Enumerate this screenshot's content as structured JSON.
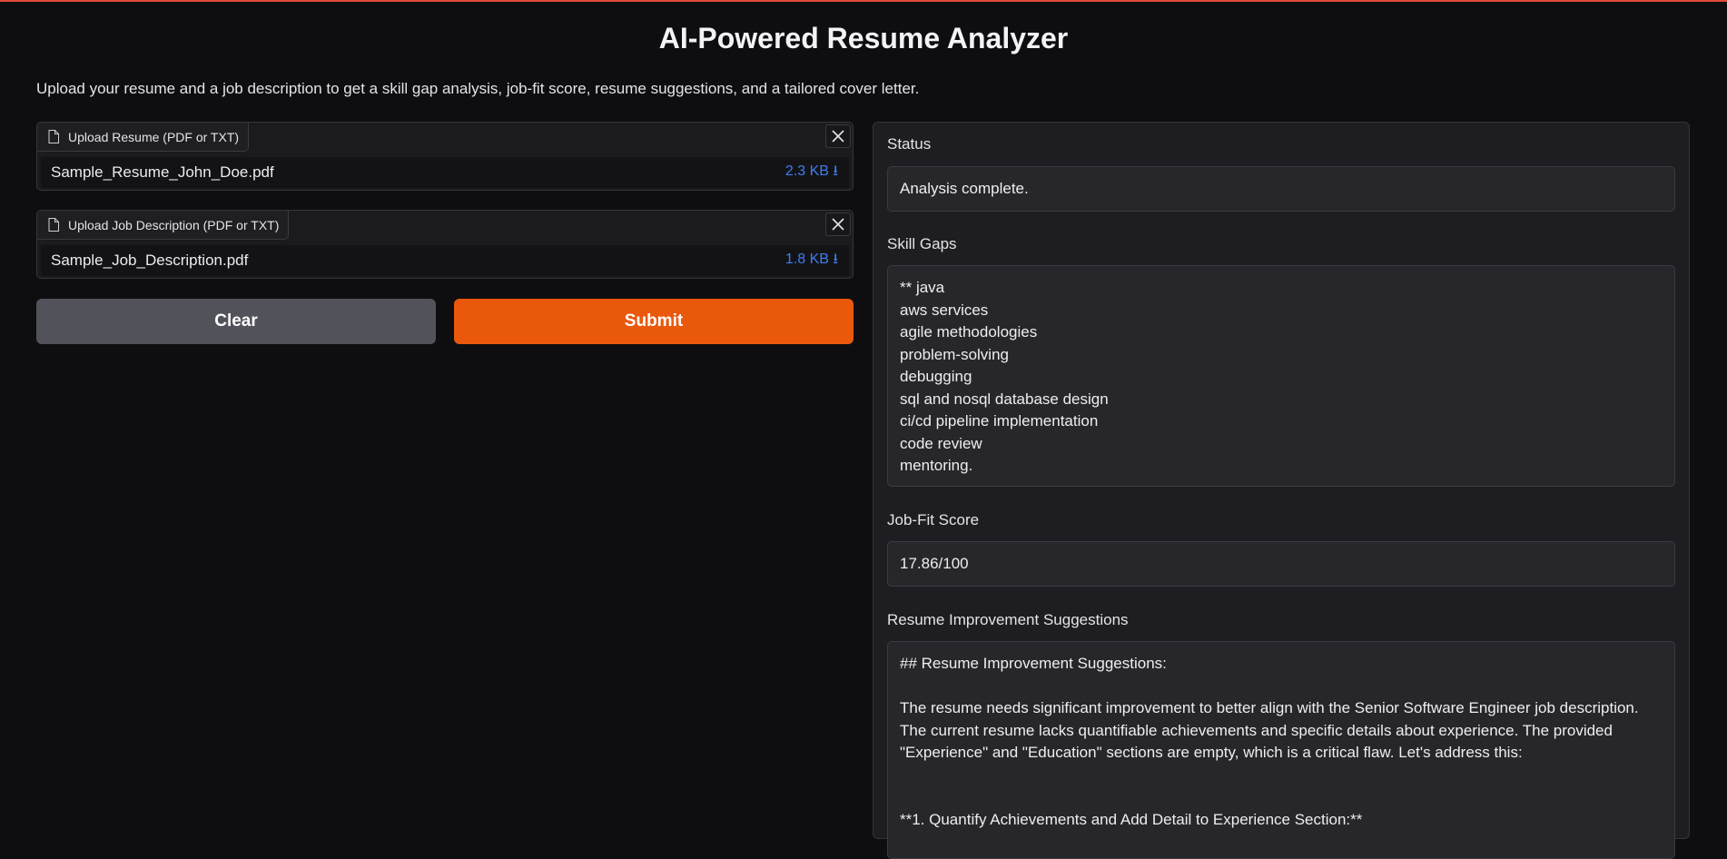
{
  "app": {
    "title": "AI-Powered Resume Analyzer",
    "description": "Upload your resume and a job description to get a skill gap analysis, job-fit score, resume suggestions, and a tailored cover letter."
  },
  "inputs": {
    "resume": {
      "label": "Upload Resume (PDF or TXT)",
      "file_name": "Sample_Resume_John_Doe.pdf",
      "file_size": "2.3 KB ⭳"
    },
    "job_description": {
      "label": "Upload Job Description (PDF or TXT)",
      "file_name": "Sample_Job_Description.pdf",
      "file_size": "1.8 KB ⭳"
    }
  },
  "buttons": {
    "clear": "Clear",
    "submit": "Submit"
  },
  "outputs": {
    "status": {
      "label": "Status",
      "value": "Analysis complete."
    },
    "skill_gaps": {
      "label": "Skill Gaps",
      "lines": [
        "** java",
        "aws services",
        "agile methodologies",
        "problem-solving",
        "debugging",
        "sql and nosql database design",
        "ci/cd pipeline implementation",
        "code review",
        "mentoring."
      ]
    },
    "job_fit": {
      "label": "Job-Fit Score",
      "value": "17.86/100"
    },
    "suggestions": {
      "label": "Resume Improvement Suggestions",
      "heading": "## Resume Improvement Suggestions:",
      "paragraph": "The resume needs significant improvement to better align with the Senior Software Engineer job description.  The current resume lacks quantifiable achievements and specific details about experience.  The provided \"Experience\" and \"Education\" sections are empty, which is a critical flaw.  Let's address this:",
      "item1": "**1.  Quantify Achievements and Add Detail to Experience Section:**"
    }
  },
  "colors": {
    "accent_submit": "#ea580c",
    "clear_button": "#52525b",
    "file_size_link": "#3f7ef0",
    "background": "#0e0e11"
  },
  "icons": [
    "file-icon",
    "close-icon"
  ]
}
